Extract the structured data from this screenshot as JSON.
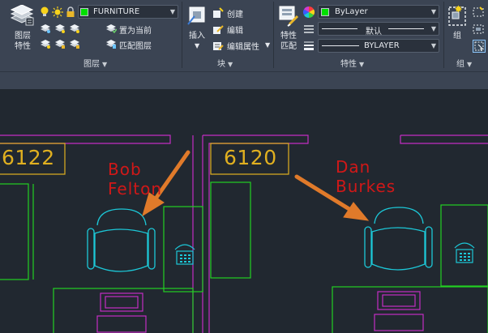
{
  "ribbon": {
    "layer_panel": {
      "big_button_line1": "图层",
      "big_button_line2": "特性",
      "layer_combo_value": "FURNITURE",
      "make_current_label": "置为当前",
      "match_layer_label": "匹配图层",
      "panel_title": "图层"
    },
    "block_panel": {
      "insert_label": "插入",
      "create_label": "创建",
      "edit_label": "编辑",
      "edit_attributes_label": "编辑属性",
      "panel_title": "块"
    },
    "properties_panel": {
      "match_properties_line1": "特性",
      "match_properties_line2": "匹配",
      "color_combo_value": "ByLayer",
      "linetype_combo_value": "默认",
      "lineweight_combo_value": "BYLAYER",
      "panel_title": "特性"
    },
    "groups_panel": {
      "group_label": "组",
      "panel_title": "组"
    }
  },
  "drawing": {
    "room_numbers": [
      "6122",
      "6120"
    ],
    "occupants": [
      {
        "first": "Bob",
        "last": "Felton"
      },
      {
        "first": "Dan",
        "last": "Burkes"
      }
    ]
  },
  "colors": {
    "ribbon_bg": "#3b4453",
    "canvas_bg": "#212830",
    "layer_green": "#00e000",
    "wall_magenta": "#c42dc4",
    "furniture_green": "#22d022",
    "chair_cyan": "#1cc8d8",
    "room_tag_yellow": "#e0b020",
    "name_red": "#d01818",
    "arrow_orange": "#e07a2a"
  },
  "icons": [
    "layer-properties-icon",
    "lightbulb-icon",
    "sun-icon",
    "lock-icon",
    "insert-block-icon",
    "create-block-icon",
    "edit-block-icon",
    "edit-attributes-icon",
    "match-properties-icon",
    "color-wheel-icon",
    "linetype-icon",
    "lineweight-icon",
    "group-icon",
    "telephone-icon"
  ]
}
